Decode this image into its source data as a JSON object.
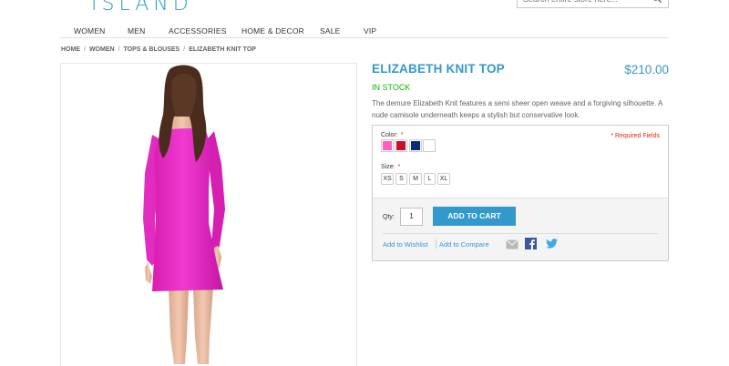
{
  "header": {
    "logo_text": "ISLAND",
    "search_placeholder": "Search entire store here..."
  },
  "nav": {
    "items": [
      "WOMEN",
      "MEN",
      "ACCESSORIES",
      "HOME & DECOR",
      "SALE",
      "VIP"
    ]
  },
  "breadcrumbs": [
    "HOME",
    "WOMEN",
    "TOPS & BLOUSES",
    "ELIZABETH KNIT TOP"
  ],
  "breadcrumb_separator": "/",
  "product": {
    "title": "ELIZABETH KNIT TOP",
    "price": "$210.00",
    "stock": "IN STOCK",
    "description": "The demure Elizabeth Knit features a semi sheer open weave and a forgiving silhouette. A nude camisole underneath keeps a stylish but conservative look."
  },
  "options": {
    "required_note": "* Required Fields",
    "color_label": "Color:",
    "size_label": "Size:",
    "required_star": "*",
    "colors": [
      "#ff5fc0",
      "#c8102e",
      "#0d2a7a",
      "#ffffff"
    ],
    "sizes": [
      "XS",
      "S",
      "M",
      "L",
      "XL"
    ]
  },
  "purchase": {
    "qty_label": "Qty:",
    "qty_value": "1",
    "add_to_cart": "ADD TO CART",
    "wishlist": "Add to Wishlist",
    "compare": "Add to Compare"
  },
  "icons": {
    "email": "email-icon",
    "facebook": "facebook-icon",
    "twitter": "twitter-icon"
  },
  "colors": {
    "accent": "#3399cc",
    "in_stock": "#11b400",
    "required": "#df280a",
    "dress": "#ef2fc8"
  }
}
